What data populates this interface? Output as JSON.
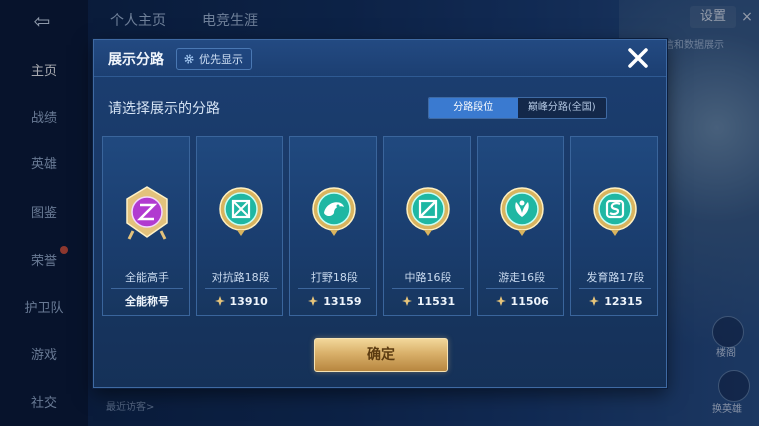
{
  "background": {
    "nav_items": [
      "主页",
      "战绩",
      "英雄",
      "图鉴",
      "荣誉",
      "护卫队",
      "游戏",
      "社交"
    ],
    "top_tabs": [
      "个人主页",
      "电竞生涯"
    ],
    "settings_label": "设置",
    "settings_close": "×",
    "note_text": "信和数据展示",
    "recent_label": "最近访客>",
    "label_a": "楼阁",
    "label_b": "换英雄"
  },
  "modal": {
    "title": "展示分路",
    "priority_button": "优先显示",
    "prompt": "请选择展示的分路",
    "segment": {
      "options": [
        "分路段位",
        "巅峰分路(全国)"
      ],
      "selected": "分路段位"
    },
    "cards": [
      {
        "title": "全能高手",
        "footer": "全能称号",
        "emblem": "all-round-emblem",
        "color": "#b13bd0"
      },
      {
        "title": "对抗路18段",
        "score": "13910",
        "emblem": "clash-lane-emblem",
        "color": "#1fb7a3"
      },
      {
        "title": "打野18段",
        "score": "13159",
        "emblem": "jungle-emblem",
        "color": "#1fb7a3"
      },
      {
        "title": "中路16段",
        "score": "11531",
        "emblem": "mid-lane-emblem",
        "color": "#1fb7a3"
      },
      {
        "title": "游走16段",
        "score": "11506",
        "emblem": "roam-emblem",
        "color": "#1fb7a3"
      },
      {
        "title": "发育路17段",
        "score": "12315",
        "emblem": "farm-lane-emblem",
        "color": "#1fb7a3"
      }
    ],
    "confirm_label": "确定"
  },
  "colors": {
    "accent": "#3a7ad0",
    "gold": "#d9b06a",
    "panel": "#1c3f72"
  }
}
